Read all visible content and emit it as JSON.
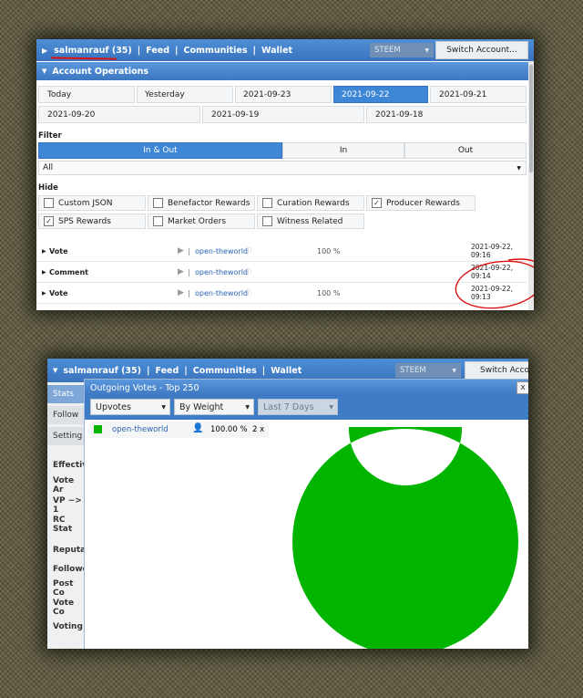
{
  "top_panel": {
    "nav": {
      "user": "salmanrauf (35)",
      "feed": "Feed",
      "communities": "Communities",
      "wallet": "Wallet",
      "separator": "|"
    },
    "steem_select": "STEEM",
    "switch_account": "Switch Account...",
    "section_title": "Account Operations",
    "dates": [
      "Today",
      "Yesterday",
      "2021-09-23",
      "2021-09-22",
      "2021-09-21",
      "2021-09-20",
      "2021-09-19",
      "2021-09-18"
    ],
    "filter_label": "Filter",
    "filter_tabs": [
      "In & Out",
      "In",
      "Out"
    ],
    "filter_select": "All",
    "hide_label": "Hide",
    "hide_options": [
      {
        "label": "Custom JSON",
        "checked": false
      },
      {
        "label": "Benefactor Rewards",
        "checked": false
      },
      {
        "label": "Curation Rewards",
        "checked": false
      },
      {
        "label": "Producer Rewards",
        "checked": true
      },
      {
        "label": "SPS Rewards",
        "checked": true
      },
      {
        "label": "Market Orders",
        "checked": false
      },
      {
        "label": "Witness Related",
        "checked": false
      }
    ],
    "operations": [
      {
        "type": "Vote",
        "user": "open-theworld",
        "percent": "100 %",
        "time": "2021-09-22, 09:16"
      },
      {
        "type": "Comment",
        "user": "open-theworld",
        "percent": "",
        "time": "2021-09-22, 09:14"
      },
      {
        "type": "Vote",
        "user": "open-theworld",
        "percent": "100 %",
        "time": "2021-09-22, 09:13"
      }
    ]
  },
  "bottom_panel": {
    "nav": {
      "user": "salmanrauf (35)",
      "feed": "Feed",
      "communities": "Communities",
      "wallet": "Wallet",
      "separator": "|"
    },
    "steem_select": "STEEM",
    "switch_account": "Switch Accou",
    "sidebar": [
      "Stats",
      "Follow",
      "Setting",
      "Effectiv",
      "Vote Ar",
      "VP ~> 1",
      "RC Stat",
      "Reputa",
      "Followe",
      "Post Co",
      "Vote Co",
      "Voting"
    ],
    "modal": {
      "title": "Outgoing Votes - Top 250",
      "close": "x",
      "dropdowns": [
        "Upvotes",
        "By Weight",
        "Last 7 Days"
      ],
      "legend": [
        {
          "user": "open-theworld",
          "percent": "100.00 %",
          "count": "2 x"
        }
      ]
    }
  },
  "colors": {
    "accent_blue": "#3e86d6",
    "donut_green": "#00b400",
    "link_blue": "#2a63b4"
  },
  "chart_data": {
    "type": "pie",
    "title": "Outgoing Votes - Top 250",
    "categories": [
      "open-theworld"
    ],
    "values": [
      100
    ],
    "style": "donut"
  }
}
